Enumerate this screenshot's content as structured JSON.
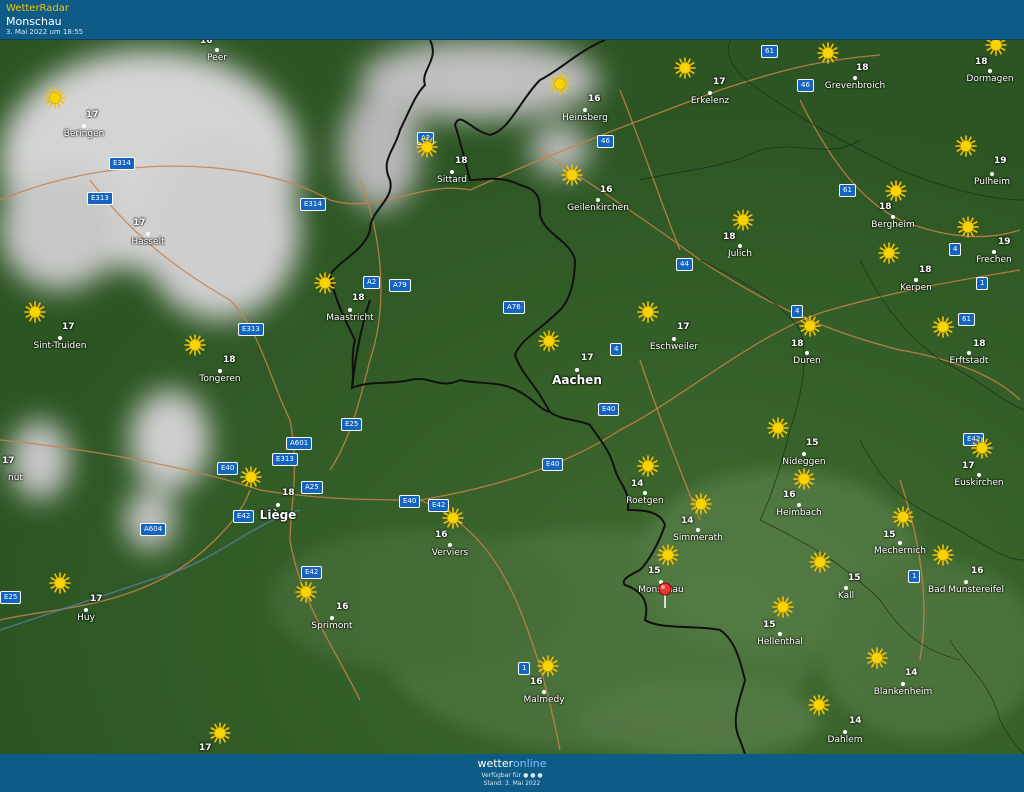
{
  "header": {
    "app_name": "WetterRadar",
    "location": "Monschau",
    "timestamp": "3. Mai 2022 um 18:55"
  },
  "footer": {
    "brand_a": "wetter",
    "brand_b": "online",
    "available": "Verfügbar für",
    "stand": "Stand: 3. Mai 2022"
  },
  "map": {
    "selected_location": "Monschau",
    "weather_icon": "sun-icon",
    "colors": {
      "terrain": "#2f5a26",
      "border": "#111111",
      "road": "#c9824a",
      "clouds": "#d9d9d9",
      "pin": "#e53935"
    }
  },
  "cities": [
    {
      "name": "Peer",
      "temp": "16"
    },
    {
      "name": "Beringen",
      "temp": "17"
    },
    {
      "name": "Hasselt",
      "temp": "17"
    },
    {
      "name": "Sint-Truiden",
      "temp": "17"
    },
    {
      "name": "Tongeren",
      "temp": "18"
    },
    {
      "name": "Maastricht",
      "temp": "18"
    },
    {
      "name": "Sittard",
      "temp": "18"
    },
    {
      "name": "Heinsberg",
      "temp": "16"
    },
    {
      "name": "Erkelenz",
      "temp": "17"
    },
    {
      "name": "Grevenbroich",
      "temp": "18"
    },
    {
      "name": "Dormagen",
      "temp": "18"
    },
    {
      "name": "Geilenkirchen",
      "temp": "16"
    },
    {
      "name": "Pulheim",
      "temp": "19"
    },
    {
      "name": "Bergheim",
      "temp": "18"
    },
    {
      "name": "Julich",
      "temp": "18"
    },
    {
      "name": "Frechen",
      "temp": "19"
    },
    {
      "name": "Kerpen",
      "temp": "18"
    },
    {
      "name": "Eschweiler",
      "temp": "17"
    },
    {
      "name": "Aachen",
      "temp": "17"
    },
    {
      "name": "Duren",
      "temp": "18"
    },
    {
      "name": "Erftstadt",
      "temp": "18"
    },
    {
      "name": "Nideggen",
      "temp": "15"
    },
    {
      "name": "Euskirchen",
      "temp": "17"
    },
    {
      "name": "Roetgen",
      "temp": "14"
    },
    {
      "name": "Heimbach",
      "temp": "16"
    },
    {
      "name": "Liège",
      "temp": "18"
    },
    {
      "name": "Verviers",
      "temp": "16"
    },
    {
      "name": "Simmerath",
      "temp": "14"
    },
    {
      "name": "Mechernich",
      "temp": "15"
    },
    {
      "name": "Monschau",
      "temp": "15"
    },
    {
      "name": "Kall",
      "temp": "15"
    },
    {
      "name": "Bad Munstereifel",
      "temp": "16"
    },
    {
      "name": "Huy",
      "temp": "17"
    },
    {
      "name": "Sprimont",
      "temp": "16"
    },
    {
      "name": "Hellenthal",
      "temp": "15"
    },
    {
      "name": "Blankenheim",
      "temp": "14"
    },
    {
      "name": "Malmedy",
      "temp": "16"
    },
    {
      "name": "Dahlem",
      "temp": "14"
    },
    {
      "name": "nut",
      "temp": "17"
    },
    {
      "name": "",
      "temp": "17"
    }
  ],
  "roads": [
    "61",
    "46",
    "A2",
    "E314",
    "46",
    "E313",
    "E314",
    "61",
    "A2",
    "A79",
    "4",
    "A76",
    "E313",
    "4",
    "4",
    "61",
    "1",
    "44",
    "E25",
    "A601",
    "E313",
    "E40",
    "E40",
    "A25",
    "E40",
    "E40",
    "E42",
    "A604",
    "E42",
    "E25",
    "E42",
    "1",
    "E42",
    "1"
  ]
}
